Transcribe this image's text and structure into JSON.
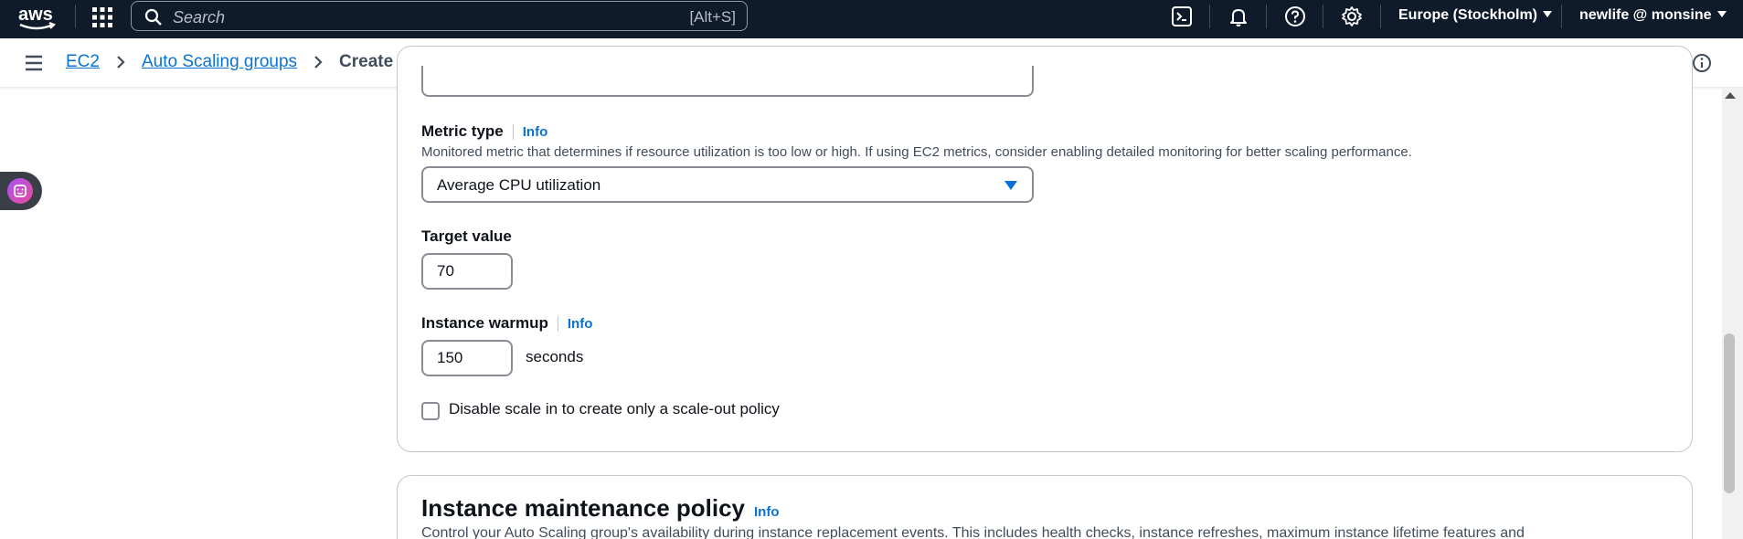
{
  "topnav": {
    "logo_text": "aws",
    "search_placeholder": "Search",
    "search_shortcut": "[Alt+S]",
    "icons": [
      "cloudshell-icon",
      "bell-icon",
      "help-icon",
      "settings-icon"
    ],
    "region": "Europe (Stockholm)",
    "user": "newlife @ monsine"
  },
  "breadcrumb": {
    "items": [
      "EC2",
      "Auto Scaling groups"
    ],
    "current": "Create Auto Scaling group"
  },
  "form": {
    "metric_type": {
      "label": "Metric type",
      "info": "Info",
      "description": "Monitored metric that determines if resource utilization is too low or high. If using EC2 metrics, consider enabling detailed monitoring for better scaling performance.",
      "value": "Average CPU utilization"
    },
    "target_value": {
      "label": "Target value",
      "value": "70"
    },
    "instance_warmup": {
      "label": "Instance warmup",
      "info": "Info",
      "value": "150",
      "units": "seconds"
    },
    "disable_scale_in": {
      "label": "Disable scale in to create only a scale-out policy",
      "checked": false
    }
  },
  "maintenance": {
    "title": "Instance maintenance policy",
    "info": "Info",
    "description": "Control your Auto Scaling group's availability during instance replacement events. This includes health checks, instance refreshes, maximum instance lifetime features and"
  },
  "colors": {
    "nav_bg": "#0f1b2a",
    "link": "#0972d3",
    "text": "#0f141a",
    "border": "#8c8c94"
  }
}
